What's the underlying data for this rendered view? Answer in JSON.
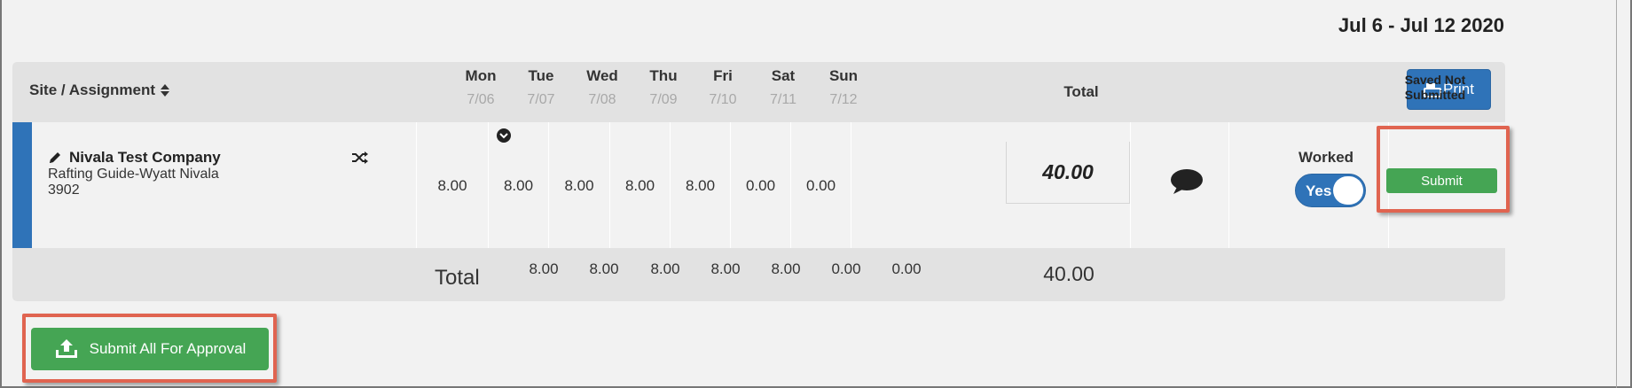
{
  "header": {
    "week_range": "Jul 6 - Jul 12 2020"
  },
  "table": {
    "site_label": "Site / Assignment",
    "days": [
      {
        "name": "Mon",
        "date": "7/06"
      },
      {
        "name": "Tue",
        "date": "7/07"
      },
      {
        "name": "Wed",
        "date": "7/08"
      },
      {
        "name": "Thu",
        "date": "7/09"
      },
      {
        "name": "Fri",
        "date": "7/10"
      },
      {
        "name": "Sat",
        "date": "7/11"
      },
      {
        "name": "Sun",
        "date": "7/12"
      }
    ],
    "total_label": "Total",
    "print_label": "Print"
  },
  "entry": {
    "company": "Nivala Test Company",
    "assignment_line1": "Rafting Guide-Wyatt Nivala",
    "assignment_line2": "3902",
    "hours": [
      "8.00",
      "8.00",
      "8.00",
      "8.00",
      "8.00",
      "0.00",
      "0.00"
    ],
    "total": "40.00",
    "worked_label": "Worked",
    "worked_toggle": "Yes",
    "status_line1": "Saved Not",
    "status_line2": "Submitted",
    "submit_label": "Submit"
  },
  "footer": {
    "total_label": "Total",
    "hours": [
      "8.00",
      "8.00",
      "8.00",
      "8.00",
      "8.00",
      "0.00",
      "0.00"
    ],
    "total": "40.00"
  },
  "actions": {
    "submit_all_label": "Submit All For Approval"
  },
  "colors": {
    "primary_blue": "#2f73b8",
    "success_green": "#45a554",
    "highlight_red": "#e06450"
  }
}
